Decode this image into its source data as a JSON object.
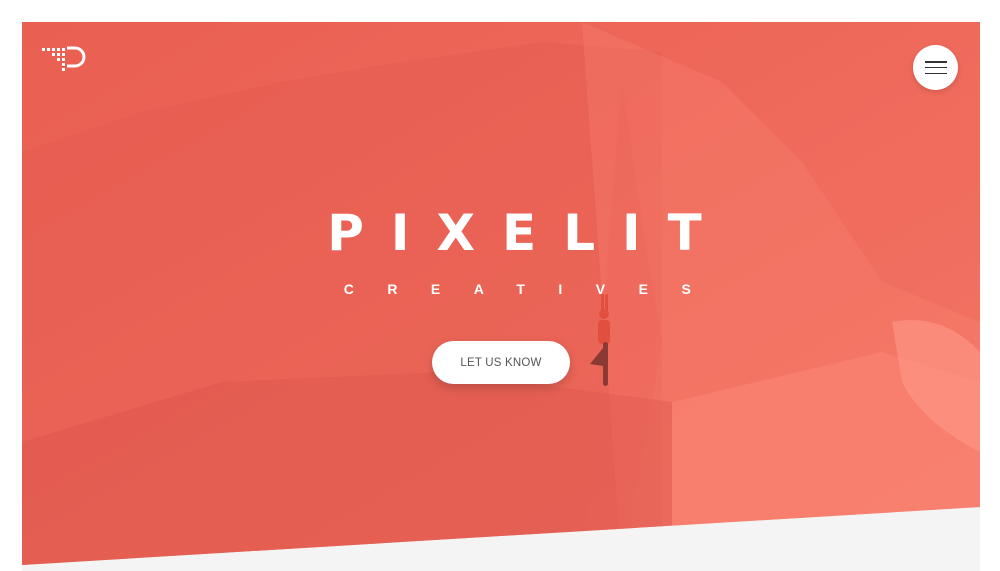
{
  "brand": {
    "logo_icon": "pixelit-p-logo-icon",
    "title": "PIXELIT",
    "subtitle": "CREATIVES"
  },
  "header": {
    "menu_icon": "hamburger-menu-icon"
  },
  "hero": {
    "cta_label": "LET US KNOW",
    "overlay_color": "#f0665a",
    "background_below": "#f4f4f4"
  },
  "colors": {
    "accent": "#f0665a",
    "text_on_accent": "#ffffff",
    "button_text": "#555555"
  }
}
